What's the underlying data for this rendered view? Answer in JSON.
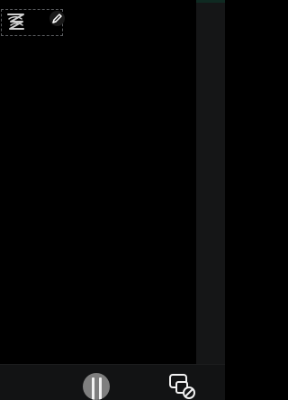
{
  "app": {
    "background_color": "#000000",
    "side_strip_color": "#151617",
    "bottom_bar_color": "#121314"
  },
  "canvas": {
    "overlay": {
      "icons": {
        "sticker": "sticker-icon",
        "edit": "pencil-edit-icon"
      }
    }
  },
  "controls": {
    "play_pause": {
      "icon": "pause-icon",
      "color": "#7f7f7f"
    },
    "device_mute": {
      "icon": "device-mute-icon"
    }
  }
}
